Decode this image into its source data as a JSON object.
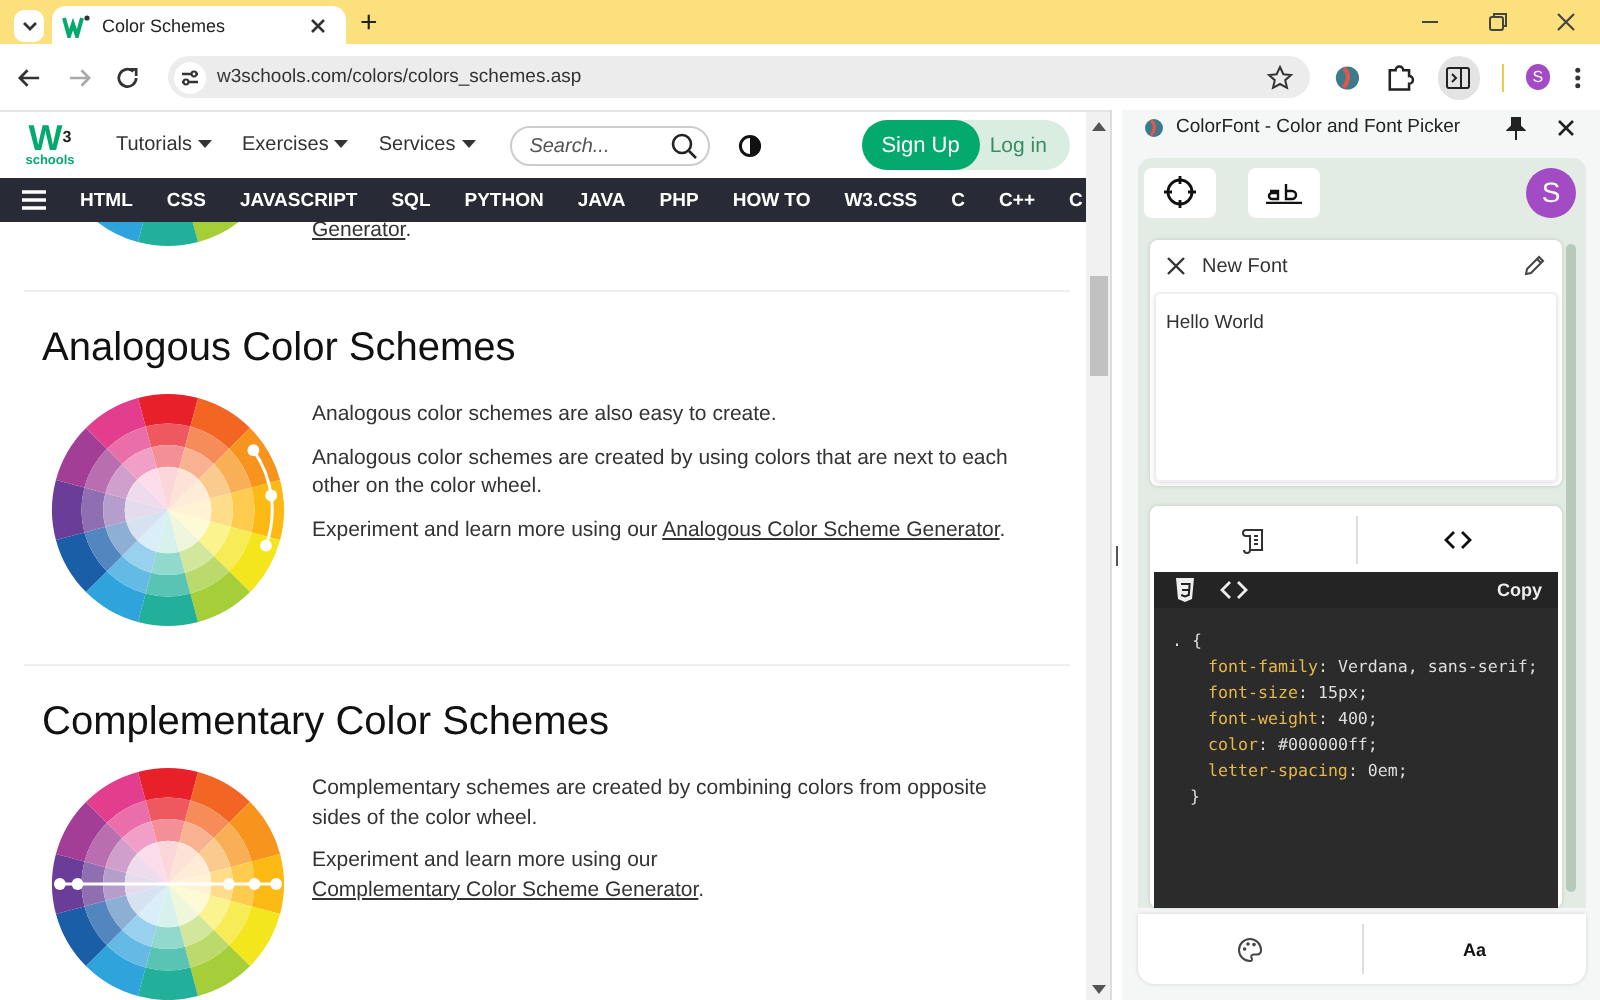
{
  "browser": {
    "tab": {
      "title": "Color Schemes"
    },
    "new_tab": "+",
    "url": "w3schools.com/colors/colors_schemes.asp",
    "profile": "S"
  },
  "site": {
    "logo": {
      "mark": "W",
      "sup": "3",
      "word": "schools"
    },
    "menus": [
      "Tutorials",
      "Exercises",
      "Services"
    ],
    "search": {
      "placeholder": "Search..."
    },
    "sign_up": "Sign Up",
    "log_in": "Log in",
    "topics": [
      "HTML",
      "CSS",
      "JAVASCRIPT",
      "SQL",
      "PYTHON",
      "JAVA",
      "PHP",
      "HOW TO",
      "W3.CSS",
      "C",
      "C++",
      "C"
    ]
  },
  "article": {
    "top_fragment": {
      "link": "Generator",
      "after": "."
    },
    "sections": [
      {
        "kind": "analogous",
        "heading": "Analogous Color Schemes",
        "paragraphs": [
          {
            "text": "Analogous color schemes are also easy to create."
          },
          {
            "text": "Analogous color schemes are created by using colors that are next to each other on the color wheel."
          },
          {
            "text": "Experiment and learn more using our ",
            "link": "Analogous Color Scheme Generator",
            "after": "."
          }
        ]
      },
      {
        "kind": "complementary",
        "heading": "Complementary Color Schemes",
        "paragraphs": [
          {
            "text": "Complementary schemes are created by combining colors from opposite sides of the color wheel."
          },
          {
            "text": "Experiment and learn more using our ",
            "link": "Complementary Color Scheme Generator",
            "after": "."
          }
        ]
      }
    ]
  },
  "side_panel": {
    "title": "ColorFont - Color and Font Picker",
    "avatar": "S",
    "font_card": {
      "name": "New Font",
      "preview": "Hello World"
    },
    "code": {
      "copy": "Copy",
      "selector": ". {",
      "lines": [
        {
          "property": "font-family",
          "value": ": Verdana, sans-serif;"
        },
        {
          "property": "font-size",
          "value": ": 15px;"
        },
        {
          "property": "font-weight",
          "value": ": 400;"
        },
        {
          "property": "color",
          "value": ": #000000ff;"
        },
        {
          "property": "letter-spacing",
          "value": ": 0em;"
        }
      ],
      "close": "}"
    },
    "font_tab_label": "Aa"
  }
}
